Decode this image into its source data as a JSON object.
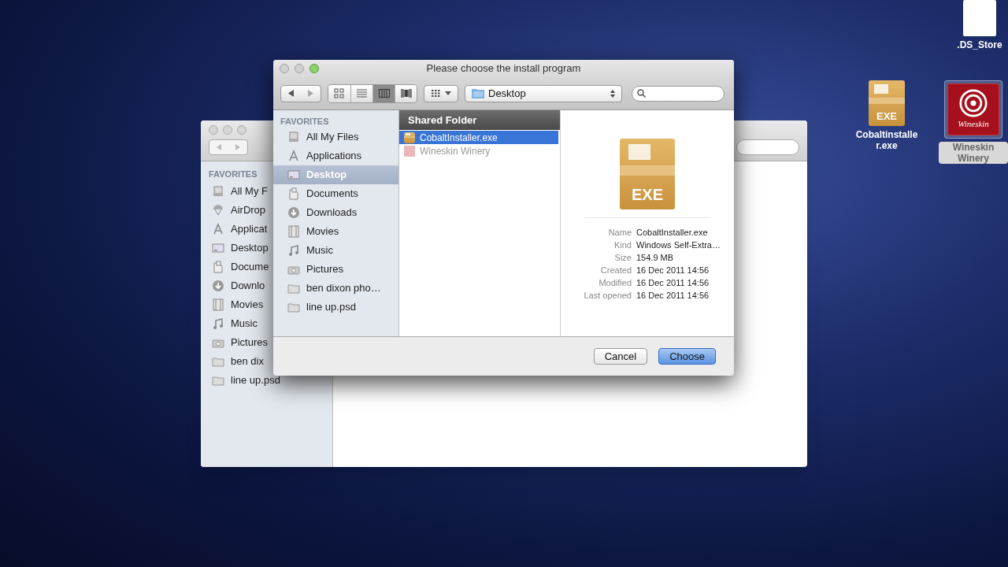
{
  "desktop_icons": [
    {
      "kind": "document",
      "label": ".DS_Store",
      "selected": false
    },
    {
      "kind": "exe",
      "label": "Cobaltinstalle r.exe",
      "icon_text": "EXE",
      "selected": false
    },
    {
      "kind": "wineskin",
      "label": "Wineskin Winery",
      "icon_text": "Wineskin",
      "selected": true
    }
  ],
  "background_window": {
    "sidebar": {
      "heading": "FAVORITES",
      "items": [
        {
          "kind": "files",
          "label": "All My F"
        },
        {
          "kind": "airdrop",
          "label": "AirDrop"
        },
        {
          "kind": "apps",
          "label": "Applicat"
        },
        {
          "kind": "desktop",
          "label": "Desktop"
        },
        {
          "kind": "documents",
          "label": "Docume"
        },
        {
          "kind": "downloads",
          "label": "Downlo"
        },
        {
          "kind": "movies",
          "label": "Movies"
        },
        {
          "kind": "music",
          "label": "Music"
        },
        {
          "kind": "pictures",
          "label": "Pictures"
        },
        {
          "kind": "folder",
          "label": "ben dix"
        },
        {
          "kind": "folder",
          "label": "line up.psd"
        }
      ]
    }
  },
  "dialog": {
    "title": "Please choose the install program",
    "view_modes": [
      {
        "kind": "icons",
        "selected": false
      },
      {
        "kind": "list",
        "selected": false
      },
      {
        "kind": "columns",
        "selected": true
      },
      {
        "kind": "coverflow",
        "selected": false
      }
    ],
    "location": "Desktop",
    "sidebar": {
      "heading": "FAVORITES",
      "items": [
        {
          "kind": "files",
          "label": "All My Files",
          "selected": false
        },
        {
          "kind": "apps",
          "label": "Applications",
          "selected": false
        },
        {
          "kind": "desktop",
          "label": "Desktop",
          "selected": true
        },
        {
          "kind": "documents",
          "label": "Documents",
          "selected": false
        },
        {
          "kind": "downloads",
          "label": "Downloads",
          "selected": false
        },
        {
          "kind": "movies",
          "label": "Movies",
          "selected": false
        },
        {
          "kind": "music",
          "label": "Music",
          "selected": false
        },
        {
          "kind": "pictures",
          "label": "Pictures",
          "selected": false
        },
        {
          "kind": "folder",
          "label": "ben dixon pho…",
          "selected": false
        },
        {
          "kind": "folder",
          "label": "line up.psd",
          "selected": false
        }
      ]
    },
    "column_header": "Shared Folder",
    "files": [
      {
        "kind": "exe",
        "name": "CobaltInstaller.exe",
        "selected": true,
        "disabled": false
      },
      {
        "kind": "wineskin",
        "name": "Wineskin Winery",
        "selected": false,
        "disabled": true
      }
    ],
    "preview": {
      "icon_text": "EXE",
      "info": [
        {
          "label": "Name",
          "value": "CobaltInstaller.exe"
        },
        {
          "label": "Kind",
          "value": "Windows Self-Extra…"
        },
        {
          "label": "Size",
          "value": "154.9 MB"
        },
        {
          "label": "Created",
          "value": "16 Dec 2011 14:56"
        },
        {
          "label": "Modified",
          "value": "16 Dec 2011 14:56"
        },
        {
          "label": "Last opened",
          "value": "16 Dec 2011 14:56"
        }
      ]
    },
    "buttons": [
      {
        "label": "Cancel",
        "default": false
      },
      {
        "label": "Choose",
        "default": true
      }
    ]
  }
}
